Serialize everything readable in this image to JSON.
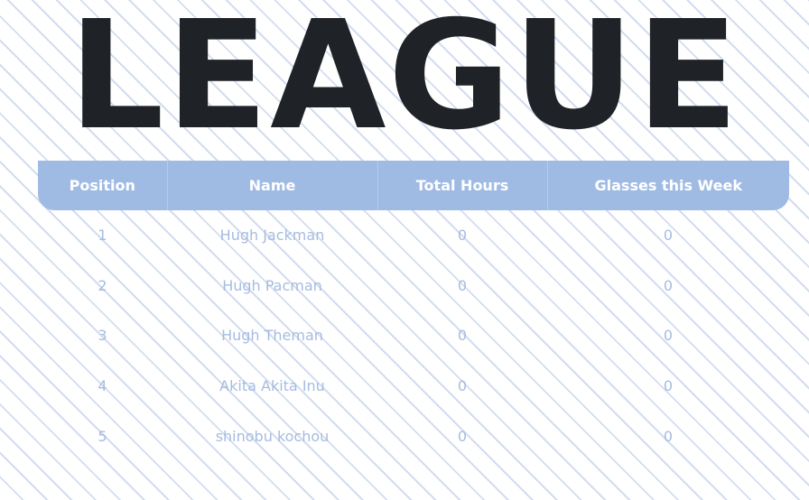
{
  "title": "LEAGUE",
  "table": {
    "headers": [
      "Position",
      "Name",
      "Total Hours",
      "Glasses this Week"
    ],
    "rows": [
      {
        "position": "1",
        "name": "Hugh Jackman",
        "total_hours": "0",
        "glasses": "0"
      },
      {
        "position": "2",
        "name": "Hugh Pacman",
        "total_hours": "0",
        "glasses": "0"
      },
      {
        "position": "3",
        "name": "Hugh Theman",
        "total_hours": "0",
        "glasses": "0"
      },
      {
        "position": "4",
        "name": "Akita Akita Inu",
        "total_hours": "0",
        "glasses": "0"
      },
      {
        "position": "5",
        "name": "shinobu kochou",
        "total_hours": "0",
        "glasses": "0"
      }
    ]
  },
  "colors": {
    "header_bg": "#9fbbe4",
    "title_text": "#1f2227",
    "cell_text": "#a5bce0",
    "stripe": "#d3ddef"
  }
}
